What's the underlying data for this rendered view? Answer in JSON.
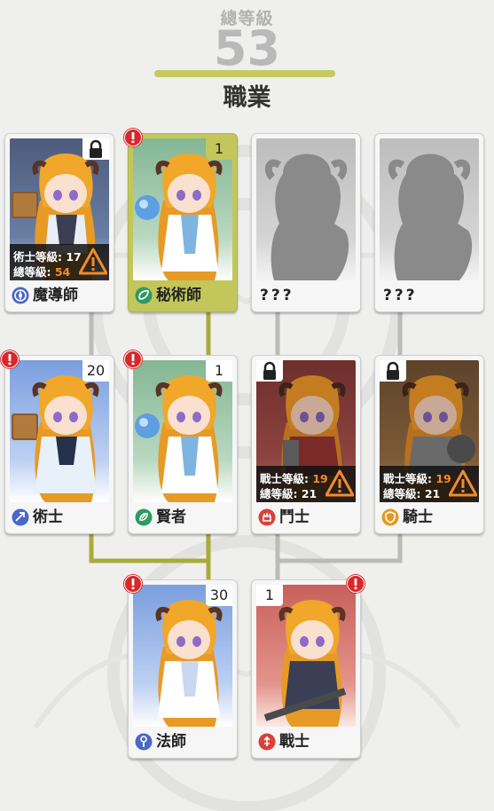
{
  "header": {
    "total_level_label": "總等級",
    "total_level": "53",
    "title": "職業"
  },
  "colors": {
    "accent": "#c3c75b",
    "alert": "#d8282c",
    "warning": "#f28b2c"
  },
  "cards": {
    "mage_guide": {
      "name": "魔導師",
      "locked": true,
      "requirements": {
        "line1_label": "術士等級:",
        "line1_value": "17",
        "line2_label": "總等級:",
        "line2_value": "54"
      }
    },
    "arcanist": {
      "name": "秘術師",
      "level": "1",
      "selected": true,
      "alert": true
    },
    "unknown_1": {
      "name": "???"
    },
    "unknown_2": {
      "name": "???"
    },
    "sorcerer": {
      "name": "術士",
      "level": "20",
      "alert": true
    },
    "sage": {
      "name": "賢者",
      "level": "1",
      "alert": true
    },
    "fighter": {
      "name": "鬥士",
      "locked": true,
      "requirements": {
        "line1_label": "戰士等級:",
        "line1_value": "19",
        "line2_label": "總等級:",
        "line2_value": "21"
      }
    },
    "knight": {
      "name": "騎士",
      "locked": true,
      "requirements": {
        "line1_label": "戰士等級:",
        "line1_value": "19",
        "line2_label": "總等級:",
        "line2_value": "21"
      }
    },
    "mage": {
      "name": "法師",
      "level": "30",
      "alert": true
    },
    "warrior": {
      "name": "戰士",
      "level": "1",
      "alert": true
    }
  }
}
